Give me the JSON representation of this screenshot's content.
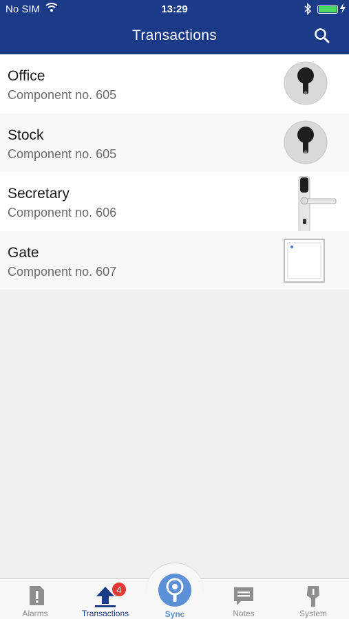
{
  "status_bar": {
    "carrier": "No SIM",
    "time": "13:29"
  },
  "header": {
    "title": "Transactions"
  },
  "transactions": [
    {
      "title": "Office",
      "subtitle": "Component no. 605",
      "icon": "cylinder-lock-icon"
    },
    {
      "title": "Stock",
      "subtitle": "Component no. 605",
      "icon": "cylinder-lock-icon"
    },
    {
      "title": "Secretary",
      "subtitle": "Component no. 606",
      "icon": "door-handle-icon"
    },
    {
      "title": "Gate",
      "subtitle": "Component no. 607",
      "icon": "wall-reader-icon"
    }
  ],
  "tabbar": {
    "alarms": "Alarms",
    "transactions": "Transactions",
    "transactions_badge": "4",
    "sync": "Sync",
    "notes": "Notes",
    "system": "System"
  },
  "colors": {
    "header_bg": "#1b3a87",
    "accent": "#5b8fd6",
    "badge": "#e53935"
  }
}
